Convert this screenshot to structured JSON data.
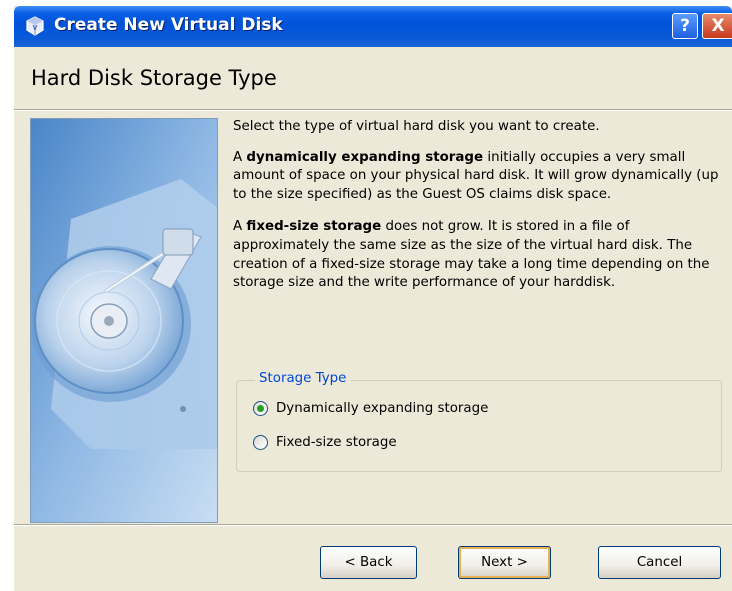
{
  "window": {
    "title": "Create New Virtual Disk",
    "help_label": "?",
    "close_label": "X"
  },
  "header": {
    "title": "Hard Disk Storage Type"
  },
  "content": {
    "intro": "Select the type of virtual hard disk you want to create.",
    "dynamic": {
      "prefix": "A ",
      "bold": "dynamically expanding storage",
      "rest": " initially occupies a very small amount of space on your physical hard disk. It will grow dynamically (up to the size specified) as the Guest OS claims disk space."
    },
    "fixed": {
      "prefix": "A ",
      "bold": "fixed-size storage",
      "rest": " does not grow. It is stored in a file of approximately the same size as the size of the virtual hard disk. The creation of a fixed-size storage may take a long time depending on the storage size and the write performance of your harddisk."
    }
  },
  "storage_type": {
    "title": "Storage Type",
    "options": [
      {
        "label": "Dynamically expanding storage",
        "selected": true
      },
      {
        "label": "Fixed-size storage",
        "selected": false
      }
    ]
  },
  "buttons": {
    "back": "< Back",
    "next": "Next >",
    "cancel": "Cancel"
  },
  "icons": {
    "title": "virtualbox-cube-icon",
    "side": "hard-disk-illustration"
  },
  "colors": {
    "titlebar": "#0a5fe4",
    "dialog_bg": "#ece9d8",
    "group_title": "#0046d5",
    "radio_selected": "#21a121"
  }
}
